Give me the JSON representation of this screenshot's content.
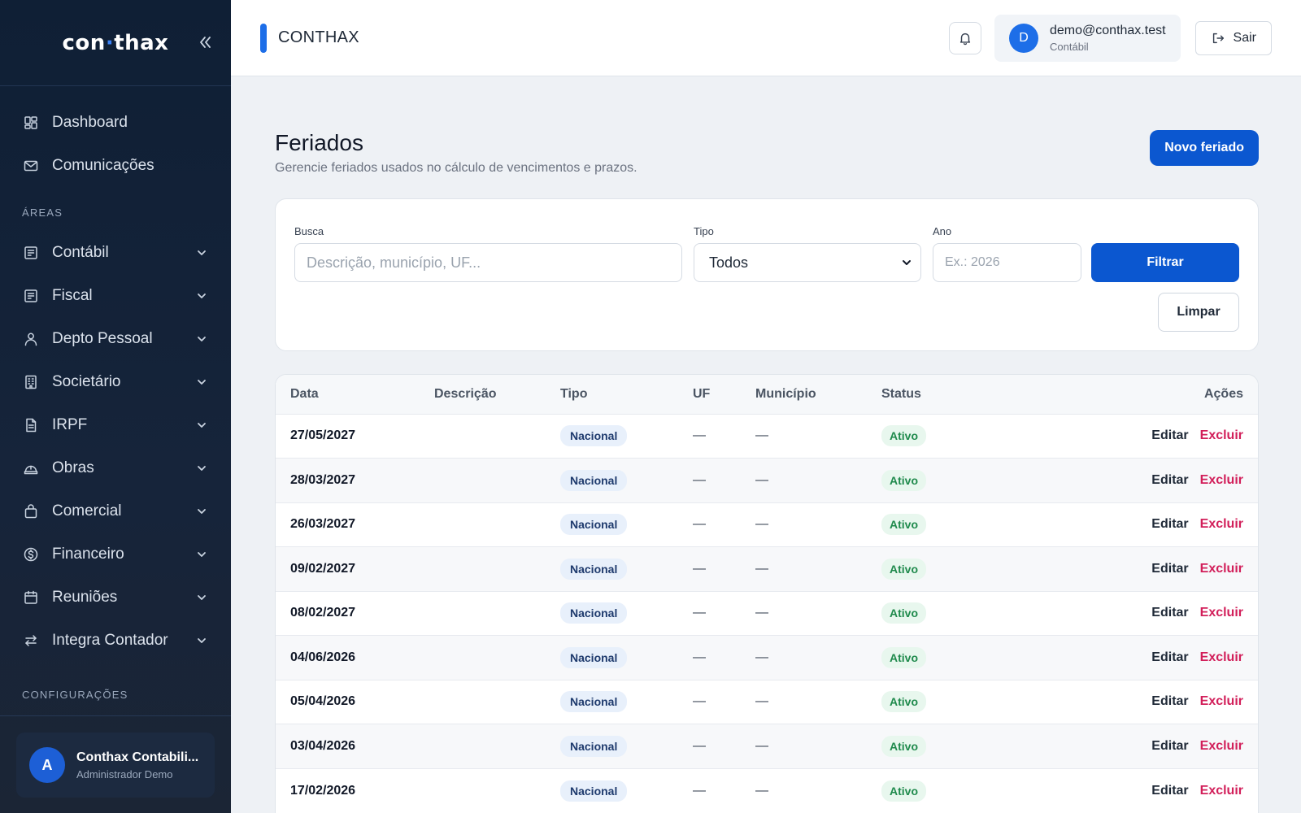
{
  "sidebar": {
    "logo_left": "con",
    "logo_dot": "·",
    "logo_right": "thax",
    "items_top": [
      {
        "label": "Dashboard",
        "icon": "dashboard-icon"
      },
      {
        "label": "Comunicações",
        "icon": "mail-icon"
      }
    ],
    "section_areas": "ÁREAS",
    "areas": [
      {
        "label": "Contábil",
        "icon": "ledger-icon"
      },
      {
        "label": "Fiscal",
        "icon": "ledger-icon"
      },
      {
        "label": "Depto Pessoal",
        "icon": "user-icon"
      },
      {
        "label": "Societário",
        "icon": "building-icon"
      },
      {
        "label": "IRPF",
        "icon": "document-icon"
      },
      {
        "label": "Obras",
        "icon": "helmet-icon"
      },
      {
        "label": "Comercial",
        "icon": "bag-icon"
      },
      {
        "label": "Financeiro",
        "icon": "dollar-icon"
      },
      {
        "label": "Reuniões",
        "icon": "calendar-icon"
      },
      {
        "label": "Integra Contador",
        "icon": "swap-icon"
      }
    ],
    "section_config": "CONFIGURAÇÕES",
    "user": {
      "initial": "A",
      "name": "Conthax Contabili...",
      "role": "Administrador Demo"
    }
  },
  "topbar": {
    "title": "CONTHAX",
    "user": {
      "initial": "D",
      "email": "demo@conthax.test",
      "role": "Contábil"
    },
    "logout_label": "Sair"
  },
  "page": {
    "title": "Feriados",
    "subtitle": "Gerencie feriados usados no cálculo de vencimentos e prazos.",
    "new_button": "Novo feriado"
  },
  "filters": {
    "busca_label": "Busca",
    "busca_placeholder": "Descrição, município, UF...",
    "tipo_label": "Tipo",
    "tipo_value": "Todos",
    "ano_label": "Ano",
    "ano_placeholder": "Ex.: 2026",
    "filter_button": "Filtrar",
    "clear_button": "Limpar"
  },
  "table": {
    "headers": [
      "Data",
      "Descrição",
      "Tipo",
      "UF",
      "Município",
      "Status",
      "Ações"
    ],
    "edit_label": "Editar",
    "delete_label": "Excluir",
    "rows": [
      {
        "data": "27/05/2027",
        "descricao": "",
        "tipo": "Nacional",
        "uf": "—",
        "municipio": "—",
        "status": "Ativo"
      },
      {
        "data": "28/03/2027",
        "descricao": "",
        "tipo": "Nacional",
        "uf": "—",
        "municipio": "—",
        "status": "Ativo"
      },
      {
        "data": "26/03/2027",
        "descricao": "",
        "tipo": "Nacional",
        "uf": "—",
        "municipio": "—",
        "status": "Ativo"
      },
      {
        "data": "09/02/2027",
        "descricao": "",
        "tipo": "Nacional",
        "uf": "—",
        "municipio": "—",
        "status": "Ativo"
      },
      {
        "data": "08/02/2027",
        "descricao": "",
        "tipo": "Nacional",
        "uf": "—",
        "municipio": "—",
        "status": "Ativo"
      },
      {
        "data": "04/06/2026",
        "descricao": "",
        "tipo": "Nacional",
        "uf": "—",
        "municipio": "—",
        "status": "Ativo"
      },
      {
        "data": "05/04/2026",
        "descricao": "",
        "tipo": "Nacional",
        "uf": "—",
        "municipio": "—",
        "status": "Ativo"
      },
      {
        "data": "03/04/2026",
        "descricao": "",
        "tipo": "Nacional",
        "uf": "—",
        "municipio": "—",
        "status": "Ativo"
      },
      {
        "data": "17/02/2026",
        "descricao": "",
        "tipo": "Nacional",
        "uf": "—",
        "municipio": "—",
        "status": "Ativo"
      }
    ]
  },
  "colors": {
    "primary": "#0b57d0",
    "sidebar": "#0f1f35",
    "danger": "#d21f5a",
    "success": "#1f8a4c"
  }
}
